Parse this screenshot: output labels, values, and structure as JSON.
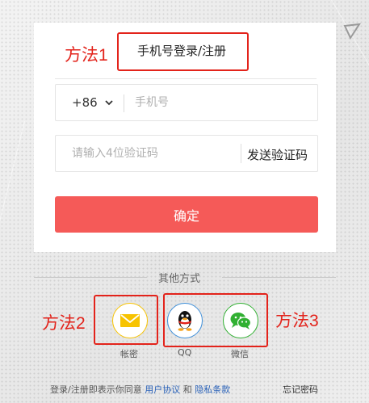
{
  "annotations": {
    "method1": "方法1",
    "method2": "方法2",
    "method3": "方法3",
    "color": "#e3231b"
  },
  "tab": {
    "label": "手机号登录/注册"
  },
  "phone": {
    "country_code": "+86",
    "placeholder": "手机号"
  },
  "code": {
    "placeholder": "请输入4位验证码",
    "send_label": "发送验证码"
  },
  "submit_label": "确定",
  "other": {
    "title": "其他方式",
    "items": [
      {
        "label": "帐密",
        "icon": "mail-icon",
        "color": "#f7c300"
      },
      {
        "label": "QQ",
        "icon": "qq-penguin-icon",
        "color": "#3d8ed8"
      },
      {
        "label": "微信",
        "icon": "wechat-icon",
        "color": "#31b032"
      }
    ]
  },
  "footer": {
    "prefix": "登录/注册即表示你同意",
    "user_agreement": "用户协议",
    "and": "和",
    "privacy": "隐私条款",
    "forgot": "忘记密码"
  },
  "colors": {
    "submit": "#f55a58",
    "link": "#2c63b8"
  }
}
